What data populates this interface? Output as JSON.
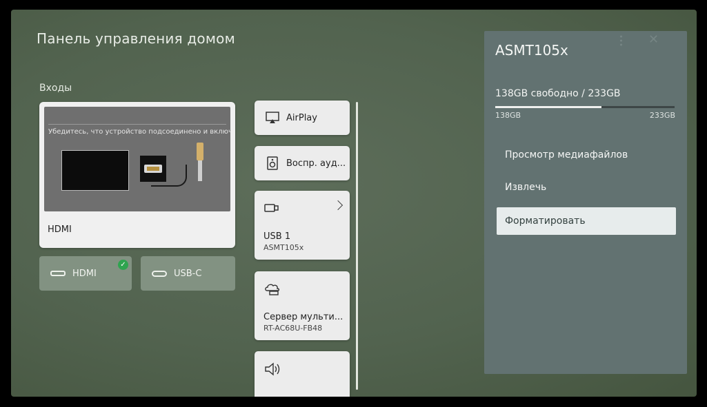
{
  "page": {
    "title": "Панель управления домом"
  },
  "inputs": {
    "heading": "Входы",
    "preview": {
      "hint": "Убедитесь, что устройство подсоединено и включено.",
      "label": "HDMI"
    },
    "sources": [
      {
        "label": "HDMI",
        "icon": "hdmi-port-icon",
        "selected": true
      },
      {
        "label": "USB-C",
        "icon": "usb-c-port-icon",
        "selected": false
      }
    ]
  },
  "devices": [
    {
      "label": "AirPlay",
      "icon": "airplay-icon"
    },
    {
      "label": "Воспр. ауд...",
      "icon": "speaker-icon"
    },
    {
      "label": "USB 1",
      "sub": "ASMT105x",
      "icon": "usb-drive-icon"
    },
    {
      "label": "Сервер мульти...",
      "sub": "RT-AC68U-FB48",
      "icon": "media-server-icon"
    },
    {
      "label": "",
      "icon": "volume-icon"
    }
  ],
  "panel": {
    "device_name": "ASMT105x",
    "storage_text": "138GB свободно / 233GB",
    "storage_free_fraction": 0.592,
    "min_label": "138GB",
    "max_label": "233GB",
    "menu": [
      {
        "label": "Просмотр медиафайлов",
        "selected": false
      },
      {
        "label": "Извлечь",
        "selected": false
      },
      {
        "label": "Форматировать",
        "selected": true
      }
    ]
  },
  "colors": {
    "background": "#52634f",
    "panel": "#627271",
    "selected": "#e7ecec",
    "check": "#2ea44f"
  }
}
